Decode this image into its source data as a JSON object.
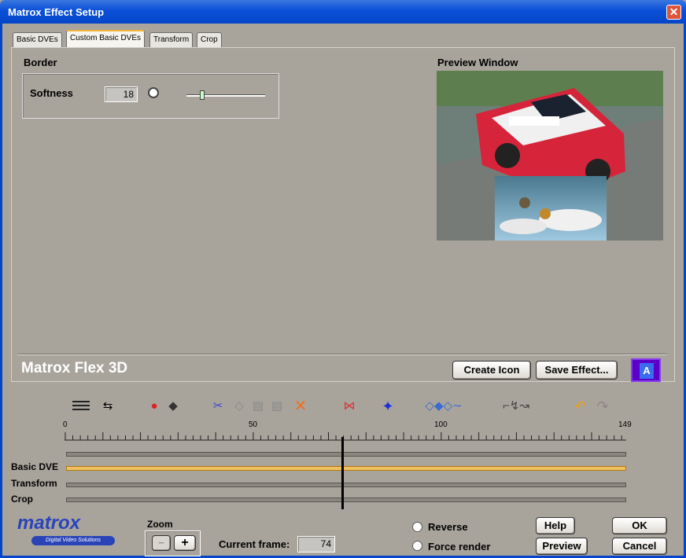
{
  "window": {
    "title": "Matrox Effect Setup",
    "close_glyph": "✕"
  },
  "tabs": [
    {
      "label": "Basic DVEs"
    },
    {
      "label": "Custom Basic DVEs",
      "active": true
    },
    {
      "label": "Transform"
    },
    {
      "label": "Crop"
    }
  ],
  "border": {
    "heading": "Border",
    "softness_label": "Softness",
    "softness_value": "18",
    "slider_fraction": 0.2
  },
  "preview": {
    "heading": "Preview Window"
  },
  "brand": "Matrox Flex 3D",
  "buttons": {
    "create_icon": "Create Icon",
    "save_effect": "Save Effect...",
    "icon_a": "A",
    "help": "Help",
    "ok": "OK",
    "preview": "Preview",
    "cancel": "Cancel"
  },
  "ruler": {
    "start": "0",
    "mid1": "50",
    "mid2": "100",
    "end": "149",
    "total_frames": 149
  },
  "tracks": [
    {
      "label": "Basic DVE"
    },
    {
      "label": "Transform"
    },
    {
      "label": "Crop"
    }
  ],
  "footer": {
    "logo": "matrox",
    "logo_sub": "Digital Video Solutions",
    "zoom_label": "Zoom",
    "zoom_minus": "−",
    "zoom_plus": "+",
    "current_frame_label": "Current frame:",
    "current_frame_value": "74",
    "reverse": "Reverse",
    "force_render": "Force render"
  },
  "colors": {
    "accent": "#f0b43a",
    "titlebar": "#0a4fd8",
    "panel": "#a8a49c"
  }
}
